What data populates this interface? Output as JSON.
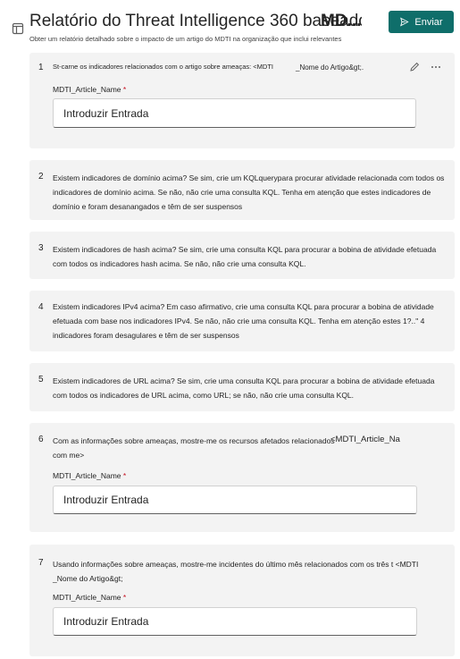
{
  "header": {
    "title": "Relatório do Threat Intelligence 360 baseado em",
    "title_overlay": "MD...",
    "subtitle": "Obter um relatório detalhado sobre o impacto de um artigo do MDTI na organização que inclui relevantes",
    "send_label": "Enviar"
  },
  "colors": {
    "accent": "#0f6e6a",
    "card": "#f3f3f3",
    "required": "#c50f1f"
  },
  "prompts": [
    {
      "number": "1",
      "text": "St-carne os indicadores relacionados com o artigo sobre ameaças: <MDTI",
      "overlay": "_Nome do Artigo&gt;.",
      "field_label": "MDTI_Article_Name",
      "required_mark": "*",
      "placeholder": "Introduzir Entrada"
    },
    {
      "number": "2",
      "text": "Existem indicadores de domínio acima? Se sim, crie um KQLquerypara procurar atividade relacionada com todos os indicadores de domínio acima. Se não, não crie uma consulta KQL. Tenha em atenção que estes indicadores de domínio e foram desanangados e têm de ser suspensos"
    },
    {
      "number": "3",
      "text": "Existem indicadores de hash acima? Se sim, crie uma consulta KQL para procurar a bobina de atividade efetuada com todos os indicadores hash acima. Se não, não crie uma consulta KQL."
    },
    {
      "number": "4",
      "text": "Existem indicadores IPv4 acima? Em caso afirmativo, crie uma consulta KQL para procurar a bobina de atividade efetuada com base nos indicadores IPv4. Se não, não crie uma consulta KQL. Tenha em atenção estes 1?..\" 4 indicadores foram desagulares e têm de ser suspensos"
    },
    {
      "number": "5",
      "text": "Existem indicadores de URL acima? Se sim, crie uma consulta KQL para procurar a bobina de atividade efetuada com todos os indicadores de URL acima, como URL; se não, não crie uma consulta KQL."
    },
    {
      "number": "6",
      "text": "Com as informações sobre ameaças, mostre-me os recursos afetados relacionados com me>",
      "overlay": "<MDTI_Article_Na",
      "field_label": "MDTI_Article_Name",
      "required_mark": "*",
      "placeholder": "Introduzir Entrada"
    },
    {
      "number": "7",
      "text": "Usando informações sobre ameaças, mostre-me incidentes do último mês relacionados com os três t <MDTI _Nome do Artigo&gt;",
      "field_label": "MDTI_Article_Name",
      "required_mark": "*",
      "placeholder": "Introduzir Entrada"
    }
  ],
  "icons": {
    "edit": "pencil-icon",
    "more": "more-options-icon",
    "send": "send-icon",
    "book": "book-icon"
  }
}
